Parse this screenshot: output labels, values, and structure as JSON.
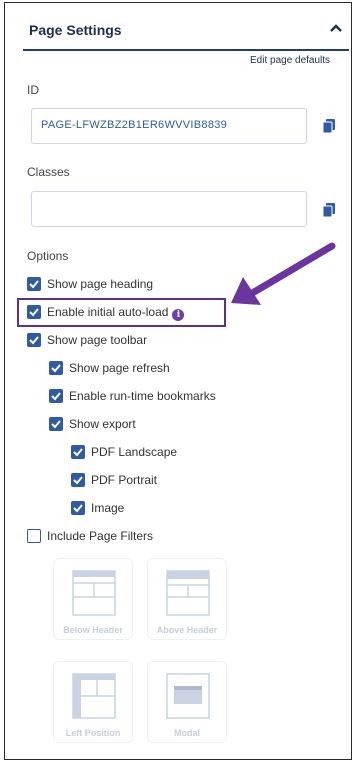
{
  "panel": {
    "title": "Page Settings",
    "edit_link": "Edit page defaults"
  },
  "id_field": {
    "label": "ID",
    "value": "PAGE-LFWZBZ2B1ER6WVVIB8839"
  },
  "classes_field": {
    "label": "Classes",
    "value": ""
  },
  "options": {
    "label": "Options",
    "items": [
      {
        "label": "Show page heading",
        "checked": true
      },
      {
        "label": "Enable initial auto-load",
        "checked": true,
        "info": "i"
      },
      {
        "label": "Show page toolbar",
        "checked": true
      },
      {
        "label": "Show page refresh",
        "checked": true
      },
      {
        "label": "Enable run-time bookmarks",
        "checked": true
      },
      {
        "label": "Show export",
        "checked": true
      },
      {
        "label": "PDF Landscape",
        "checked": true
      },
      {
        "label": "PDF Portrait",
        "checked": true
      },
      {
        "label": "Image",
        "checked": true
      },
      {
        "label": "Include Page Filters",
        "checked": false
      }
    ]
  },
  "filter_positions": [
    {
      "label": "Below Header"
    },
    {
      "label": "Above Header"
    },
    {
      "label": "Left Position"
    },
    {
      "label": "Modal"
    }
  ],
  "colors": {
    "accent": "#2f5aa4",
    "highlight": "#5e2f8c",
    "header_rule": "#1f3f79"
  }
}
